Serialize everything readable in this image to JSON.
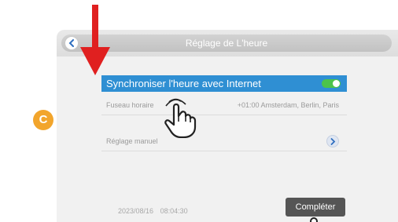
{
  "header": {
    "title": "Réglage de L'heure"
  },
  "sync_row": {
    "label": "Synchroniser l'heure avec Internet",
    "enabled": true
  },
  "timezone_row": {
    "label": "Fuseau horaire",
    "value": "+01:00 Amsterdam, Berlin, Paris"
  },
  "manual_row": {
    "label": "Réglage manuel"
  },
  "footer": {
    "date": "2023/08/16",
    "time": "08:04:30",
    "complete_label": "Compléter"
  },
  "annotation": {
    "badge": "C"
  },
  "colors": {
    "accent": "#2f8fd3",
    "toggle_on": "#4cc34a",
    "badge": "#f2a52c",
    "arrow": "#e02020"
  }
}
